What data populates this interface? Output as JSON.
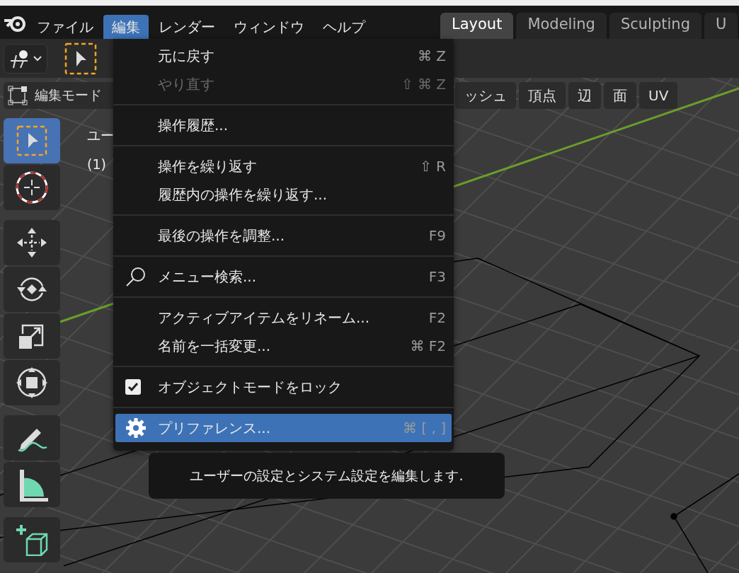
{
  "menubar": {
    "items": [
      {
        "label": "ファイル",
        "selected": false
      },
      {
        "label": "編集",
        "selected": true
      },
      {
        "label": "レンダー",
        "selected": false
      },
      {
        "label": "ウィンドウ",
        "selected": false
      },
      {
        "label": "ヘルプ",
        "selected": false
      }
    ]
  },
  "workspace_tabs": [
    {
      "label": "Layout",
      "selected": true
    },
    {
      "label": "Modeling",
      "selected": false
    },
    {
      "label": "Sculpting",
      "selected": false
    },
    {
      "label": "U",
      "selected": false
    }
  ],
  "header": {
    "mode": "編集モード",
    "menus": [
      "ッシュ",
      "頂点",
      "辺",
      "面",
      "UV"
    ]
  },
  "viewport": {
    "view_label": "ユー",
    "object_label": "(1)"
  },
  "toolbar": {
    "groups": [
      {
        "tools": [
          {
            "selected": true
          },
          {
            "selected": false
          }
        ]
      },
      {
        "tools": [
          {
            "selected": false
          },
          {
            "selected": false
          },
          {
            "selected": false
          },
          {
            "selected": false
          }
        ]
      },
      {
        "tools": [
          {
            "selected": false
          },
          {
            "selected": false
          }
        ]
      },
      {
        "tools": [
          {
            "selected": false
          }
        ]
      }
    ]
  },
  "edit_menu": {
    "groups": [
      {
        "items": [
          {
            "kind": "command",
            "label": "元に戻す",
            "shortcut": "⌘ Z",
            "disabled": false,
            "selected": false
          },
          {
            "kind": "command",
            "label": "やり直す",
            "shortcut": "⇧ ⌘ Z",
            "disabled": true,
            "selected": false
          }
        ]
      },
      {
        "items": [
          {
            "kind": "command",
            "label": "操作履歴...",
            "disabled": false,
            "selected": false
          }
        ]
      },
      {
        "items": [
          {
            "kind": "command",
            "label": "操作を繰り返す",
            "shortcut": "⇧ R",
            "disabled": false,
            "selected": false
          },
          {
            "kind": "command",
            "label": "履歴内の操作を繰り返す...",
            "disabled": false,
            "selected": false
          }
        ]
      },
      {
        "items": [
          {
            "kind": "command",
            "label": "最後の操作を調整...",
            "shortcut": "F9",
            "disabled": false,
            "selected": false
          }
        ]
      },
      {
        "items": [
          {
            "kind": "search",
            "label": "メニュー検索...",
            "shortcut": "F3",
            "disabled": false,
            "selected": false
          }
        ]
      },
      {
        "items": [
          {
            "kind": "command",
            "label": "アクティブアイテムをリネーム...",
            "shortcut": "F2",
            "disabled": false,
            "selected": false
          },
          {
            "kind": "command",
            "label": "名前を一括変更...",
            "shortcut": "⌘ F2",
            "disabled": false,
            "selected": false
          }
        ]
      },
      {
        "items": [
          {
            "kind": "checkbox",
            "label": "オブジェクトモードをロック",
            "checked": true,
            "disabled": false,
            "selected": false
          }
        ]
      },
      {
        "items": [
          {
            "kind": "settings",
            "label": "プリファレンス...",
            "shortcut": "⌘ [ , ]",
            "disabled": false,
            "selected": true
          }
        ]
      }
    ]
  },
  "tooltip": {
    "text": "ユーザーの設定とシステム設定を編集します."
  }
}
